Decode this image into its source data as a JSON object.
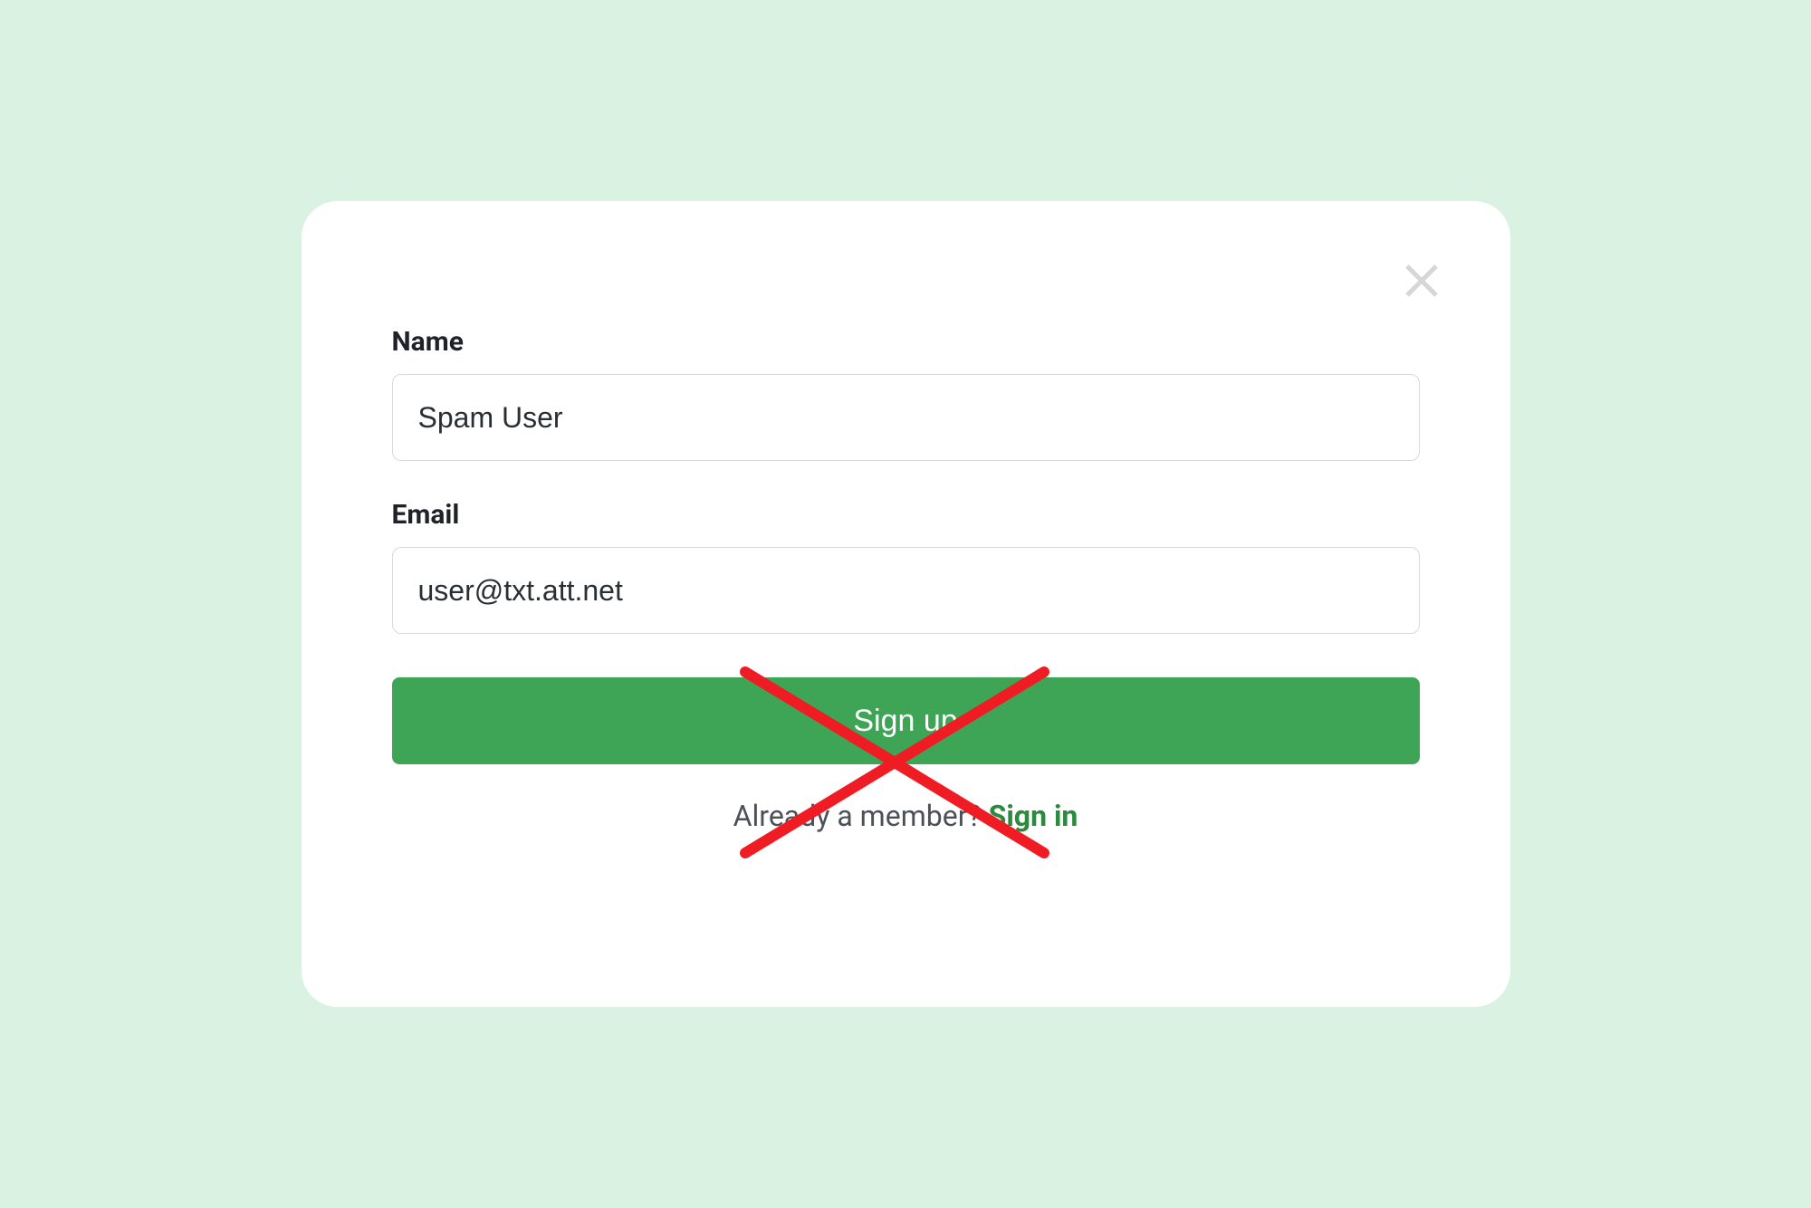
{
  "form": {
    "fields": {
      "name": {
        "label": "Name",
        "value": "Spam User"
      },
      "email": {
        "label": "Email",
        "value": "user@txt.att.net"
      }
    },
    "submit_label": "Sign up"
  },
  "footer": {
    "prompt": "Already a member? ",
    "link_label": "Sign in"
  },
  "colors": {
    "accent": "#3fa556",
    "cross": "#ef1c24"
  }
}
